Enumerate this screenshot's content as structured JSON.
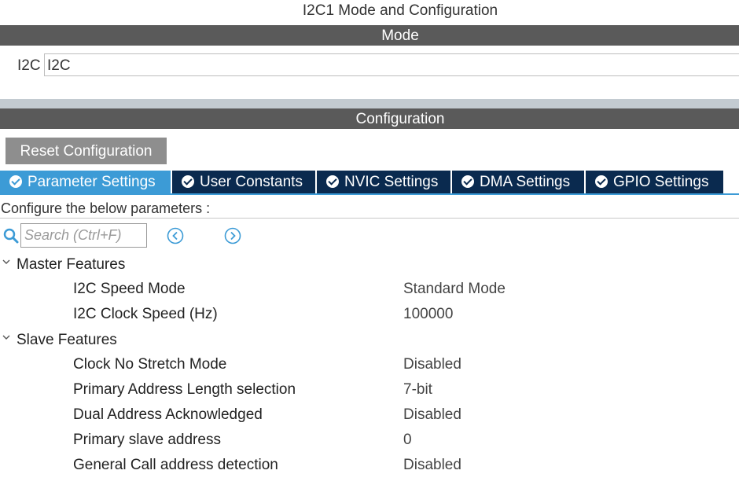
{
  "window": {
    "title": "I2C1 Mode and Configuration"
  },
  "mode": {
    "header": "Mode",
    "field_label": "I2C",
    "field_value": "I2C"
  },
  "configuration": {
    "header": "Configuration",
    "reset_button": "Reset Configuration",
    "tabs": [
      {
        "label": "Parameter Settings",
        "active": true
      },
      {
        "label": "User Constants",
        "active": false
      },
      {
        "label": "NVIC Settings",
        "active": false
      },
      {
        "label": "DMA Settings",
        "active": false
      },
      {
        "label": "GPIO Settings",
        "active": false
      }
    ],
    "instruction": "Configure the below parameters :",
    "search_placeholder": "Search (Ctrl+F)",
    "groups": [
      {
        "name": "Master Features",
        "params": [
          {
            "name": "I2C Speed Mode",
            "value": "Standard Mode"
          },
          {
            "name": "I2C Clock Speed (Hz)",
            "value": "100000"
          }
        ]
      },
      {
        "name": "Slave Features",
        "params": [
          {
            "name": "Clock No Stretch Mode",
            "value": "Disabled"
          },
          {
            "name": "Primary Address Length selection",
            "value": "7-bit"
          },
          {
            "name": "Dual Address Acknowledged",
            "value": "Disabled"
          },
          {
            "name": "Primary slave address",
            "value": "0"
          },
          {
            "name": "General Call address detection",
            "value": "Disabled"
          }
        ]
      }
    ]
  },
  "colors": {
    "header_bar": "#5a5a5a",
    "tab_active": "#3c9bd6",
    "tab_inactive": "#0a2a4f",
    "reset_button": "#8e8e8e",
    "accent_icon": "#3c9bd6"
  },
  "icons": {
    "tab_status": "check-circle-icon",
    "search": "search-icon",
    "previous": "chevron-left-circle-icon",
    "next": "chevron-right-circle-icon",
    "group_toggle": "chevron-down-icon"
  }
}
